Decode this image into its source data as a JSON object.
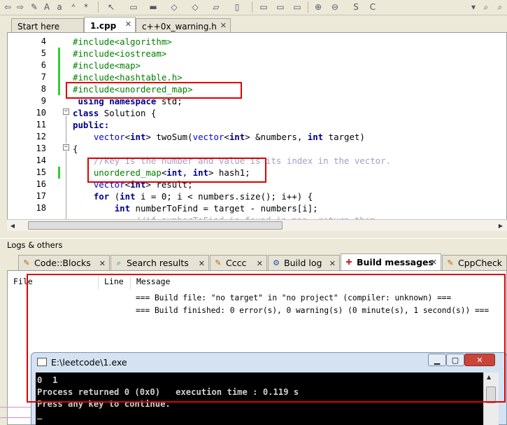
{
  "editor_tabs": [
    {
      "label": "Start here"
    },
    {
      "label": "1.cpp"
    },
    {
      "label": "c++0x_warning.h"
    }
  ],
  "code_lines": [
    {
      "n": "4"
    },
    {
      "n": "5"
    },
    {
      "n": "6"
    },
    {
      "n": "7"
    },
    {
      "n": "8"
    },
    {
      "n": "9"
    },
    {
      "n": "10"
    },
    {
      "n": "11"
    },
    {
      "n": "12"
    },
    {
      "n": "13"
    },
    {
      "n": "14"
    },
    {
      "n": "15"
    },
    {
      "n": "16"
    },
    {
      "n": "17"
    },
    {
      "n": "18"
    }
  ],
  "code": {
    "l4": "#include<algorithm>",
    "l5": "#include<iostream>",
    "l6": "#include<map>",
    "l7": "#include<hashtable.h>",
    "l8": "#include<unordered_map>",
    "l9_kw": "using namespace",
    "l9_rest": " std;",
    "l10_kw": "class",
    "l10_rest": " Solution {",
    "l11": "public:",
    "l12_a": "vector",
    "l12_b": "<",
    "l12_c": "int",
    "l12_d": "> twoSum(",
    "l12_e": "vector",
    "l12_f": "<",
    "l12_g": "int",
    "l12_h": "> &numbers, ",
    "l12_i": "int",
    "l12_j": " target)",
    "l13": "{",
    "l14": "//key is the number and value is its index in the vector.",
    "l15_a": "unordered_map",
    "l15_b": "<",
    "l15_c": "int",
    "l15_d": ", ",
    "l15_e": "int",
    "l15_f": "> hash1;",
    "l16_a": "vector",
    "l16_b": "<",
    "l16_c": "int",
    "l16_d": "> result;",
    "l17_a": "for",
    "l17_b": " (",
    "l17_c": "int",
    "l17_d": " i = 0; i < numbers.size(); i++) {",
    "l18_a": "int",
    "l18_b": " numberToFind = target - numbers[i];",
    "l19": "//if numberToFind is found in map, return them"
  },
  "logs": {
    "title": "Logs & others",
    "tabs": [
      {
        "label": "Code::Blocks",
        "icon": "codeblocks-icon"
      },
      {
        "label": "Search results",
        "icon": "search-icon"
      },
      {
        "label": "Cccc",
        "icon": "cccc-icon"
      },
      {
        "label": "Build log",
        "icon": "gear-icon"
      },
      {
        "label": "Build messages",
        "icon": "build-messages-icon"
      },
      {
        "label": "CppCheck",
        "icon": "cppcheck-icon"
      }
    ],
    "columns": {
      "file": "File",
      "line": "Line",
      "message": "Message"
    },
    "messages": [
      "=== Build file: \"no target\" in \"no project\" (compiler: unknown) ===",
      "=== Build finished: 0 error(s), 0 warning(s) (0 minute(s), 1 second(s)) ==="
    ]
  },
  "console": {
    "title": "E:\\leetcode\\1.exe",
    "lines": [
      "0  1",
      "Process returned 0 (0x0)   execution time : 0.119 s",
      "Press any key to continue."
    ],
    "cursor": "_"
  },
  "colors": {
    "highlight": "#e00000",
    "preprocessor": "#008000",
    "keyword": "#00008b"
  }
}
